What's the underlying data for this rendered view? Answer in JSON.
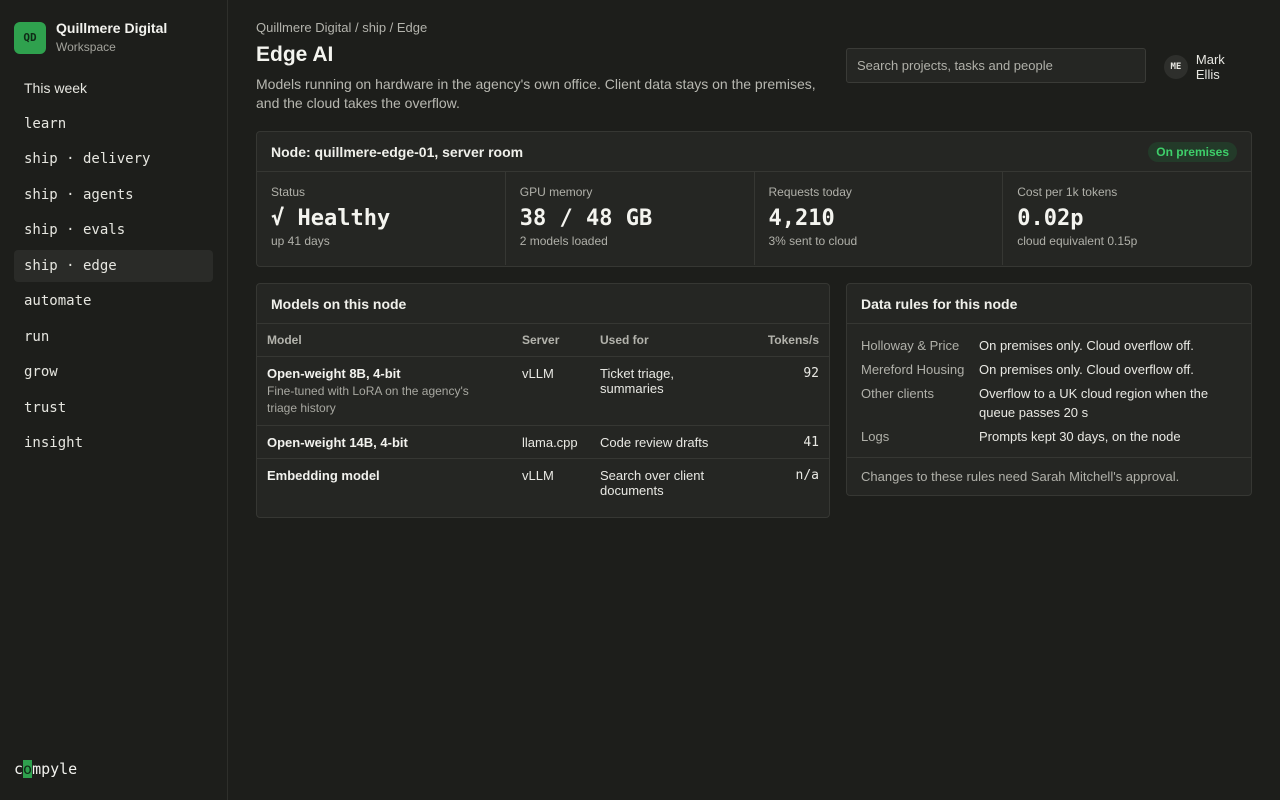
{
  "workspace": {
    "initials": "QD",
    "name": "Quillmere Digital",
    "subtitle": "Workspace"
  },
  "nav": [
    {
      "label": "This week"
    },
    {
      "label": "learn"
    },
    {
      "label": "ship · delivery"
    },
    {
      "label": "ship · agents"
    },
    {
      "label": "ship · evals"
    },
    {
      "label": "ship · edge",
      "active": true
    },
    {
      "label": "automate"
    },
    {
      "label": "run"
    },
    {
      "label": "grow"
    },
    {
      "label": "trust"
    },
    {
      "label": "insight"
    }
  ],
  "brand": {
    "pre": "c",
    "hl": "o",
    "post": "mpyle"
  },
  "breadcrumb": "Quillmere Digital / ship / Edge",
  "page": {
    "title": "Edge AI",
    "description": "Models running on hardware in the agency's own office. Client data stays on the premises, and the cloud takes the overflow."
  },
  "search": {
    "placeholder": "Search projects, tasks and people"
  },
  "user": {
    "initials": "ME",
    "name": "Mark Ellis"
  },
  "node": {
    "title": "Node: quillmere-edge-01, server room",
    "badge": "On premises",
    "badge_color": "#3ecf6a",
    "stats": [
      {
        "label": "Status",
        "value": "√ Healthy",
        "sub": "up 41 days"
      },
      {
        "label": "GPU memory",
        "value": "38 / 48 GB",
        "sub": "2 models loaded"
      },
      {
        "label": "Requests today",
        "value": "4,210",
        "sub": "3% sent to cloud"
      },
      {
        "label": "Cost per 1k tokens",
        "value": "0.02p",
        "sub": "cloud equivalent 0.15p"
      }
    ]
  },
  "models": {
    "title": "Models on this node",
    "columns": [
      "Model",
      "Server",
      "Used for",
      "Tokens/s"
    ],
    "rows": [
      {
        "model": "Open-weight 8B, 4-bit",
        "note": "Fine-tuned with LoRA on the agency's triage history",
        "server": "vLLM",
        "used_for": "Ticket triage, summaries",
        "tokens": "92"
      },
      {
        "model": "Open-weight 14B, 4-bit",
        "note": "",
        "server": "llama.cpp",
        "used_for": "Code review drafts",
        "tokens": "41"
      },
      {
        "model": "Embedding model",
        "note": "",
        "server": "vLLM",
        "used_for": "Search over client documents",
        "tokens": "n/a"
      }
    ]
  },
  "rules": {
    "title": "Data rules for this node",
    "items": [
      {
        "key": "Holloway & Price",
        "value": "On premises only. Cloud overflow off."
      },
      {
        "key": "Mereford Housing",
        "value": "On premises only. Cloud overflow off."
      },
      {
        "key": "Other clients",
        "value": "Overflow to a UK cloud region when the queue passes 20 s"
      },
      {
        "key": "Logs",
        "value": "Prompts kept 30 days, on the node"
      }
    ],
    "footer": "Changes to these rules need Sarah Mitchell's approval."
  }
}
